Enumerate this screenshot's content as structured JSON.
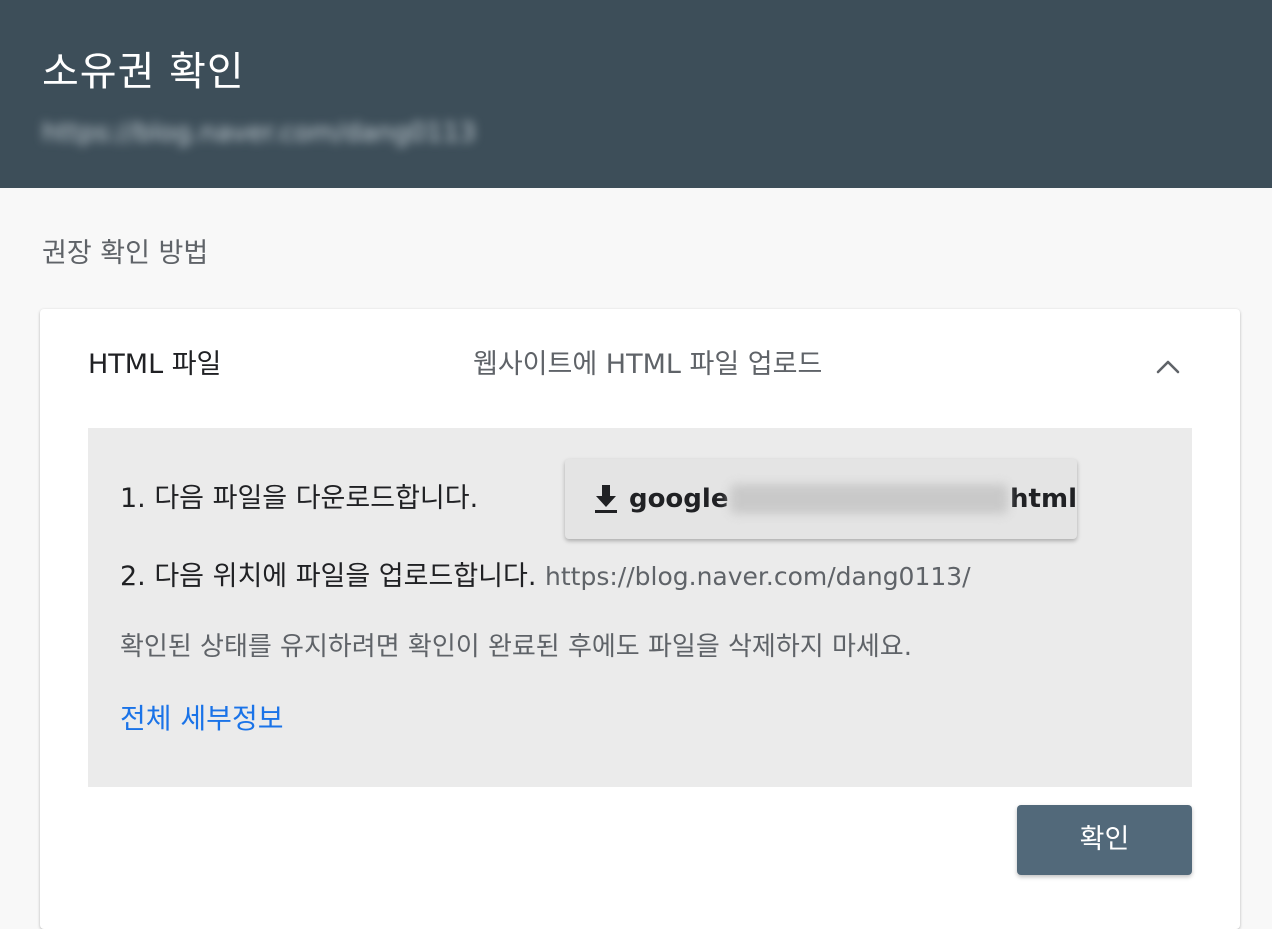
{
  "header": {
    "title": "소유권 확인",
    "url": "https://blog.naver.com/dang0113"
  },
  "section": {
    "label": "권장 확인 방법"
  },
  "method": {
    "name": "HTML 파일",
    "description": "웹사이트에 HTML 파일 업로드",
    "expanded_icon": "chevron-up-icon"
  },
  "steps": {
    "step1": "1. 다음 파일을 다운로드합니다.",
    "step2": "2. 다음 위치에 파일을 업로드합니다.",
    "upload_path": "https://blog.naver.com/dang0113/",
    "note": "확인된 상태를 유지하려면 확인이 완료된 후에도 파일을 삭제하지 마세요.",
    "details_link": "전체 세부정보"
  },
  "download": {
    "icon": "download-icon",
    "prefix": "google",
    "suffix": "html"
  },
  "actions": {
    "confirm_label": "확인"
  },
  "colors": {
    "header_bg": "#3d4e59",
    "link": "#1a73e8",
    "confirm_bg": "#52697a",
    "panel_bg": "#ebebeb"
  }
}
